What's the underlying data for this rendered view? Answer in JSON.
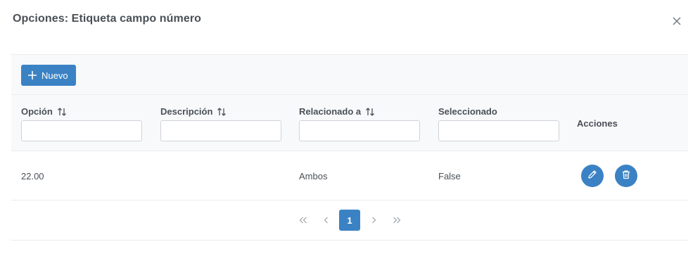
{
  "dialog": {
    "title": "Opciones: Etiqueta campo número",
    "close_icon": "close-icon"
  },
  "toolbar": {
    "new_label": "Nuevo",
    "new_icon": "plus-icon"
  },
  "table": {
    "columns": [
      {
        "label": "Opción",
        "sortable": true,
        "filter_value": ""
      },
      {
        "label": "Descripción",
        "sortable": true,
        "filter_value": ""
      },
      {
        "label": "Relacionado a",
        "sortable": true,
        "filter_value": ""
      },
      {
        "label": "Seleccionado",
        "sortable": false,
        "filter_value": ""
      },
      {
        "label": "Acciones",
        "sortable": false
      }
    ],
    "rows": [
      {
        "opcion": "22.00",
        "descripcion": "",
        "relacionado": "Ambos",
        "seleccionado": "False"
      }
    ]
  },
  "paginator": {
    "current_page": "1",
    "icons": [
      "first-page-icon",
      "prev-page-icon",
      "next-page-icon",
      "last-page-icon"
    ]
  },
  "colors": {
    "accent": "#3b82c4",
    "header_bg": "#f8f9fa",
    "border": "#e9ecef",
    "text": "#495057"
  }
}
